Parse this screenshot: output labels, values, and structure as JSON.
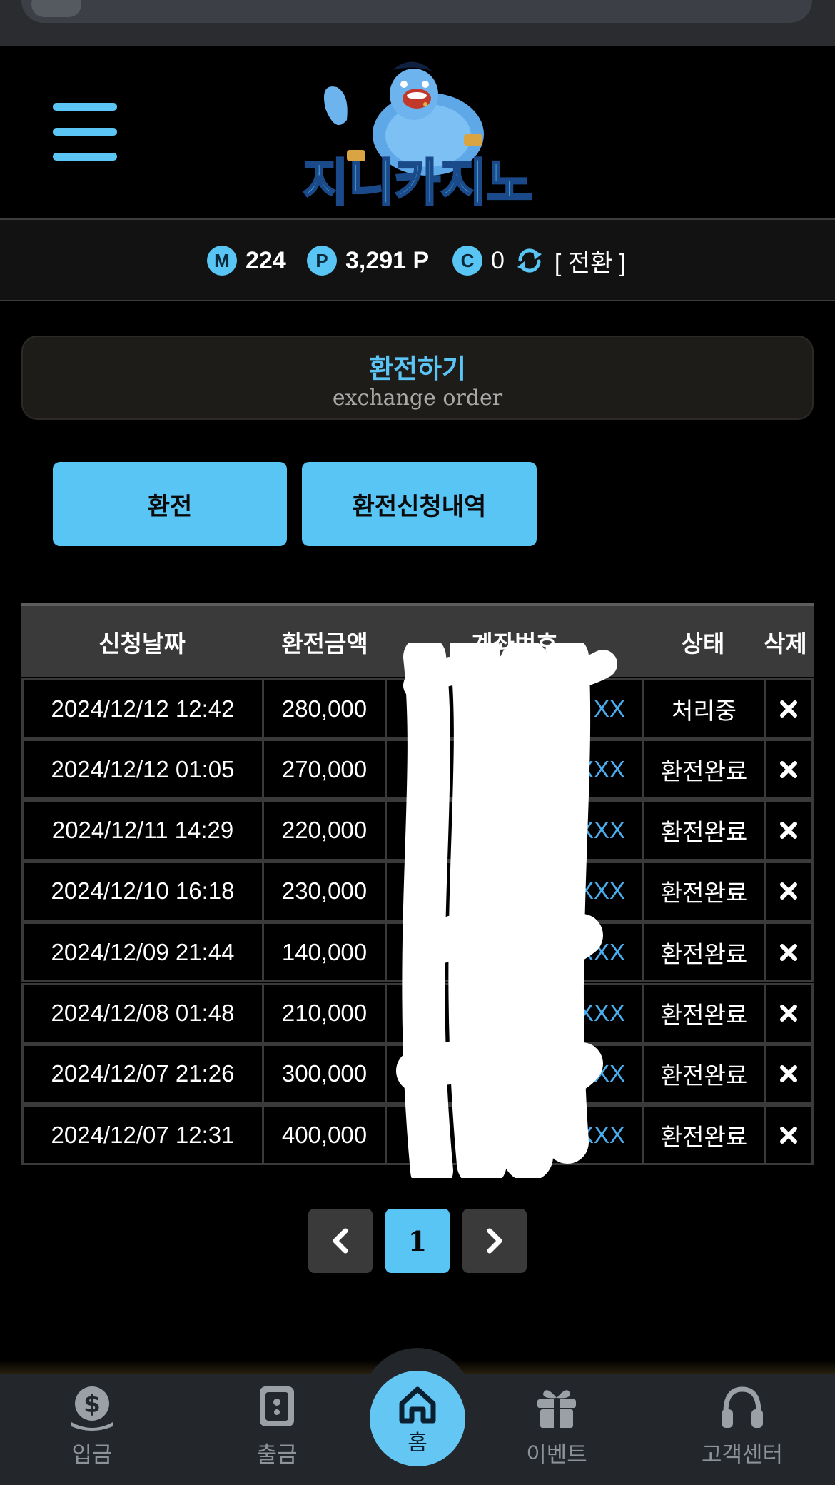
{
  "logo": {
    "text": "지니카지노"
  },
  "balances": [
    {
      "icon": "M",
      "value": "224"
    },
    {
      "icon": "P",
      "value": "3,291 P"
    },
    {
      "icon": "C",
      "value": "0"
    }
  ],
  "convert_label": "[ 전환 ]",
  "page_title": {
    "main": "환전하기",
    "sub": "exchange order"
  },
  "tabs": {
    "exchange": "환전",
    "history": "환전신청내역"
  },
  "table": {
    "headers": {
      "date": "신청날짜",
      "amount": "환전금액",
      "account": "계좌번호",
      "status": "상태",
      "delete": "삭제"
    },
    "rows": [
      {
        "date": "2024/12/12 12:42",
        "amount": "280,000",
        "account": "XX",
        "status": "처리중"
      },
      {
        "date": "2024/12/12 01:05",
        "amount": "270,000",
        "account": "XXXX",
        "status": "환전완료"
      },
      {
        "date": "2024/12/11 14:29",
        "amount": "220,000",
        "account": "XXXX",
        "status": "환전완료"
      },
      {
        "date": "2024/12/10 16:18",
        "amount": "230,000",
        "account": "XXXX",
        "status": "환전완료"
      },
      {
        "date": "2024/12/09 21:44",
        "amount": "140,000",
        "account": "XXXX",
        "status": "환전완료"
      },
      {
        "date": "2024/12/08 01:48",
        "amount": "210,000",
        "account": "XXXX",
        "status": "환전완료"
      },
      {
        "date": "2024/12/07 21:26",
        "amount": "300,000",
        "account": "XXXX",
        "status": "환전완료"
      },
      {
        "date": "2024/12/07 12:31",
        "amount": "400,000",
        "account": "XXXX",
        "status": "환전완료"
      }
    ]
  },
  "pagination": {
    "current": "1"
  },
  "bottom_nav": {
    "deposit": "입금",
    "withdraw": "출금",
    "home": "홈",
    "event": "이벤트",
    "support": "고객센터"
  },
  "colors": {
    "accent": "#58c5f5",
    "background": "#000000",
    "account_text": "#4aaef0"
  }
}
